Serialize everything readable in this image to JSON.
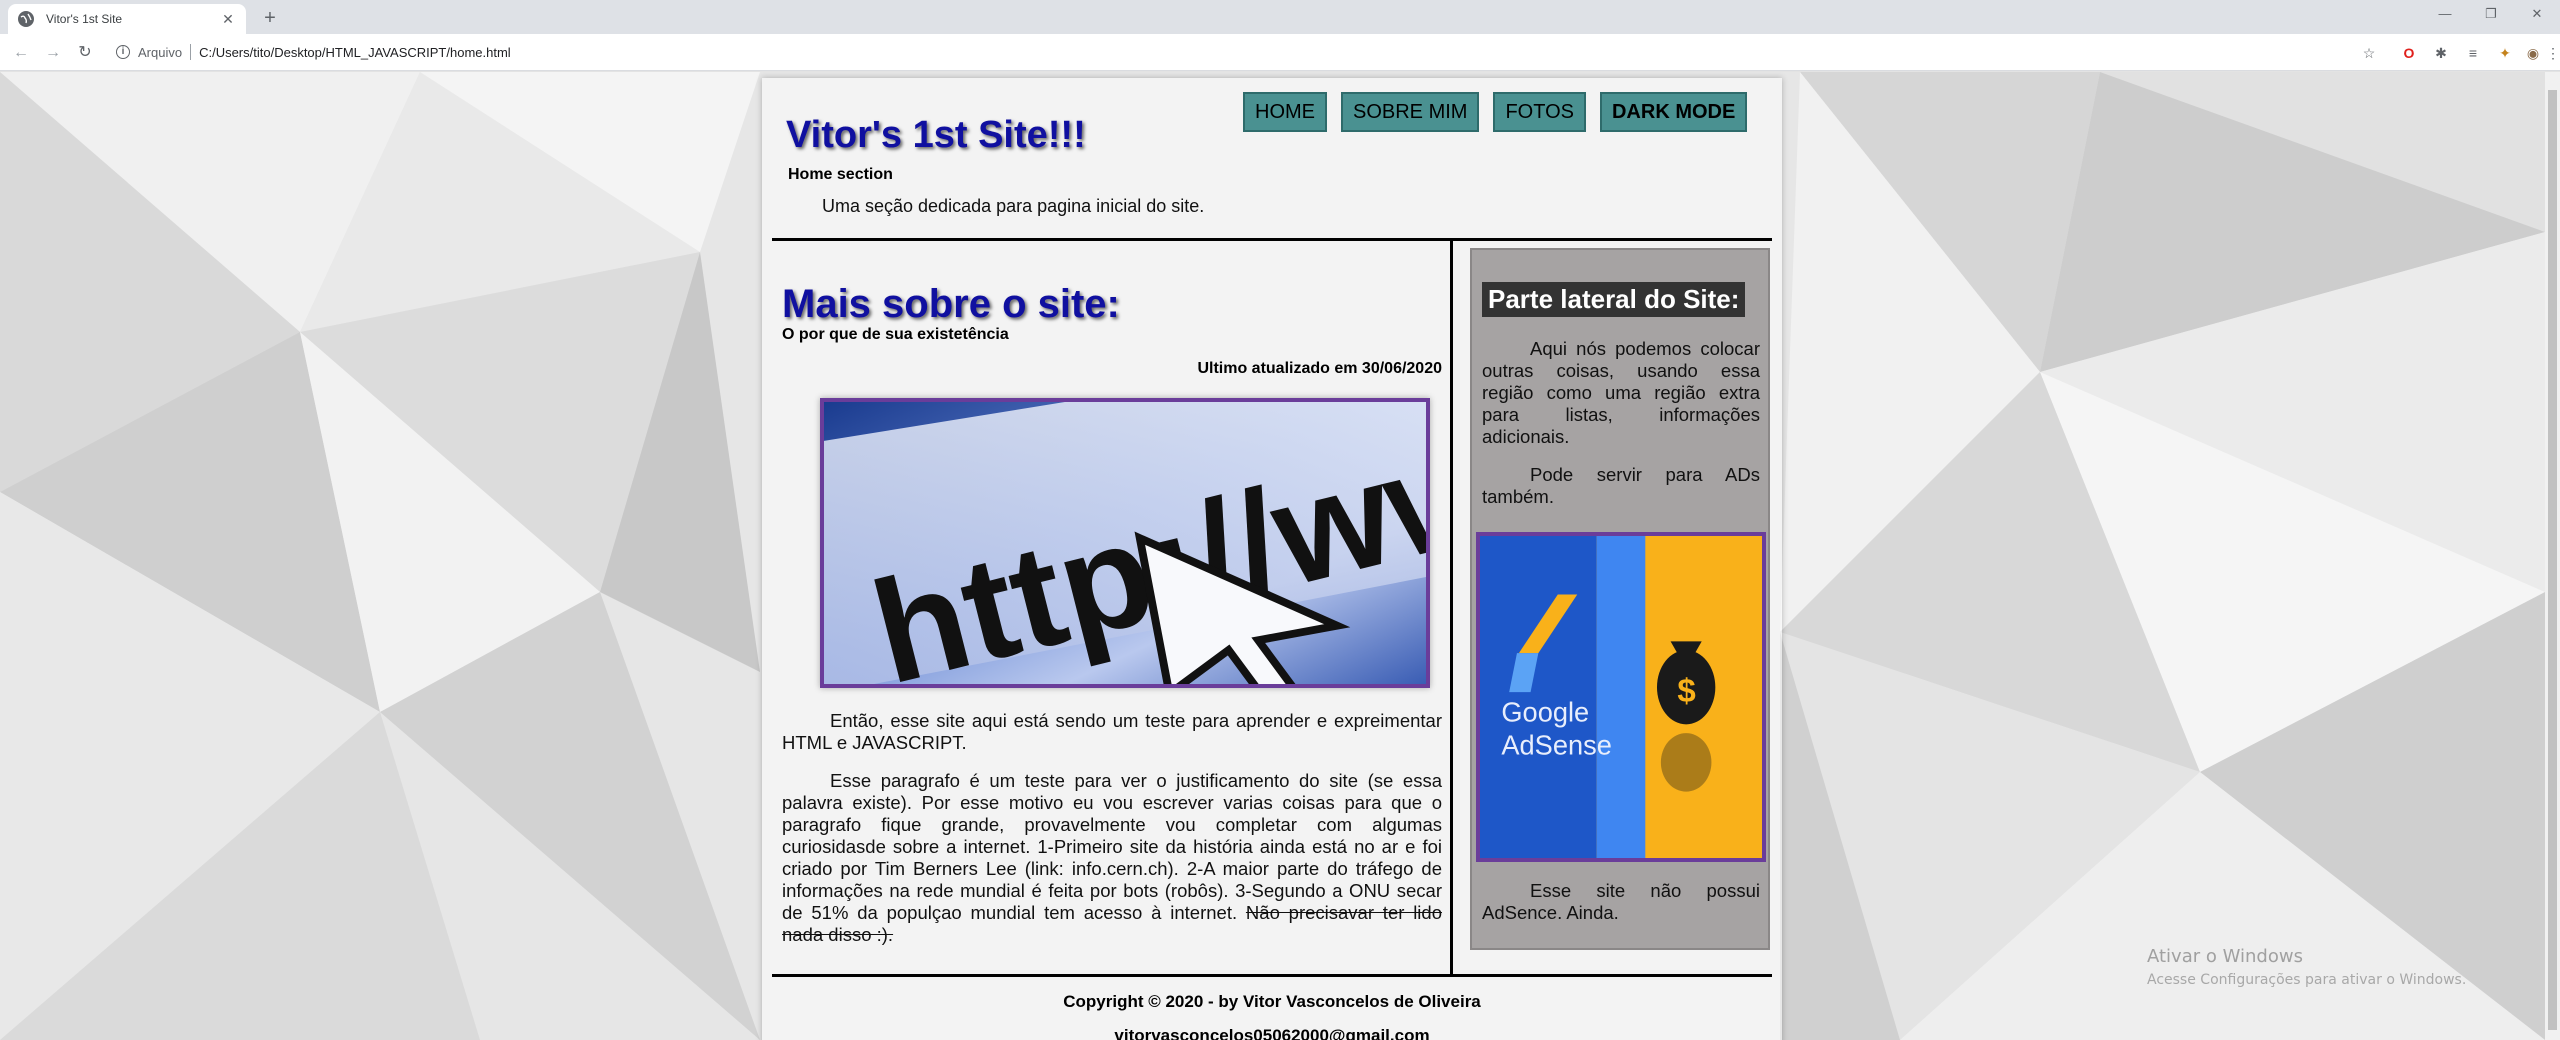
{
  "browser": {
    "tab_title": "Vitor's 1st Site",
    "address_scheme": "Arquivo",
    "address_url": "C:/Users/tito/Desktop/HTML_JAVASCRIPT/home.html"
  },
  "header": {
    "title": "Vitor's 1st Site!!!",
    "subtitle": "Home section",
    "description": "Uma seção dedicada para pagina inicial do site."
  },
  "nav": {
    "home": "HOME",
    "about": "SOBRE MIM",
    "photos": "FOTOS",
    "dark_mode": "DARK MODE"
  },
  "main": {
    "title": "Mais sobre o site:",
    "subtitle": "O por que de sua existetência",
    "updated": "Ultimo atualizado em 30/06/2020",
    "hero_text": "http://ww",
    "paragraph1": "Então, esse site aqui está sendo um teste para aprender e expreimentar HTML e JAVASCRIPT.",
    "paragraph2": "Esse paragrafo é um teste para ver o justificamento do site (se essa palavra existe). Por esse motivo eu vou escrever varias coisas para que o paragrafo fique grande, provavelmente vou completar com algumas curiosidasde sobre a internet. 1-Primeiro site da história ainda está no ar e foi criado por Tim Berners Lee (link: info.cern.ch). 2-A maior parte do tráfego de informações na rede mundial é feita por bots (robôs). 3-Segundo a ONU secar de 51% da populçao mundial tem acesso à internet.",
    "paragraph2_strike": "Não precisavar ter lido nada disso :)."
  },
  "aside": {
    "title": "Parte lateral do Site:",
    "paragraph1": "Aqui nós podemos colocar outras coisas, usando essa região como uma região extra para listas, informações adicionais.",
    "paragraph2": "Pode servir para ADs também.",
    "ad_text_line1": "Google",
    "ad_text_line2": "AdSense",
    "paragraph3": "Esse site não possui AdSence. Ainda."
  },
  "footer": {
    "copyright": "Copyright © 2020 - by Vitor Vasconcelos de Oliveira",
    "email": "vitorvasconcelos05062000@gmail.com"
  },
  "watermark": {
    "line1": "Ativar o Windows",
    "line2": "Acesse Configurações para ativar o Windows."
  }
}
